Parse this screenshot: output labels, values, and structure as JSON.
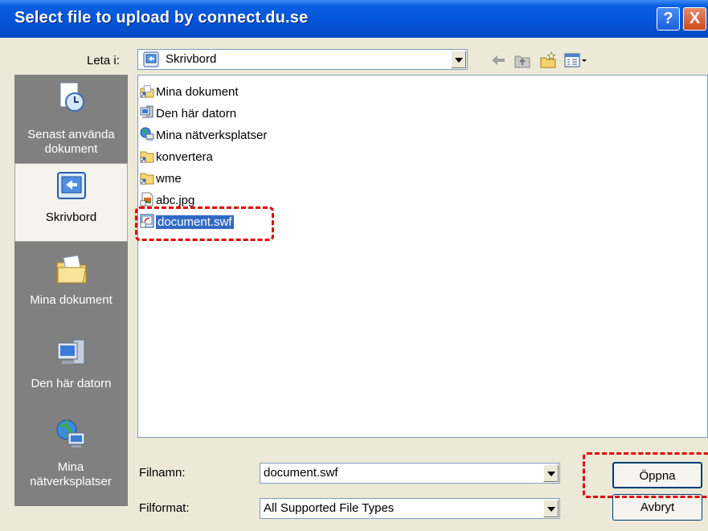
{
  "titlebar": {
    "title": "Select file to upload by connect.du.se",
    "help_glyph": "?",
    "close_glyph": "X"
  },
  "lookin": {
    "label": "Leta i:",
    "value": "Skrivbord"
  },
  "places": [
    {
      "label": "Senast använda dokument",
      "icon": "recent-documents-icon"
    },
    {
      "label": "Skrivbord",
      "icon": "desktop-icon"
    },
    {
      "label": "Mina dokument",
      "icon": "my-documents-icon"
    },
    {
      "label": "Den här datorn",
      "icon": "my-computer-icon"
    },
    {
      "label": "Mina nätverksplatser",
      "icon": "network-places-icon"
    }
  ],
  "files": [
    {
      "name": "Mina dokument",
      "icon": "my-documents-icon"
    },
    {
      "name": "Den här datorn",
      "icon": "my-computer-icon"
    },
    {
      "name": "Mina nätverksplatser",
      "icon": "network-places-icon"
    },
    {
      "name": "konvertera",
      "icon": "folder-shortcut-icon"
    },
    {
      "name": "wme",
      "icon": "folder-shortcut-icon"
    },
    {
      "name": "abc.jpg",
      "icon": "image-file-icon"
    },
    {
      "name": "document.swf",
      "icon": "swf-file-icon",
      "selected": true
    }
  ],
  "filename": {
    "label": "Filnamn:",
    "value": "document.swf"
  },
  "filetype": {
    "label": "Filformat:",
    "value": "All Supported File Types"
  },
  "buttons": {
    "open": "Öppna",
    "cancel": "Avbryt"
  },
  "colors": {
    "titlebar": "#0454d6",
    "selection": "#316ac5",
    "highlight_dash": "#e00000"
  }
}
